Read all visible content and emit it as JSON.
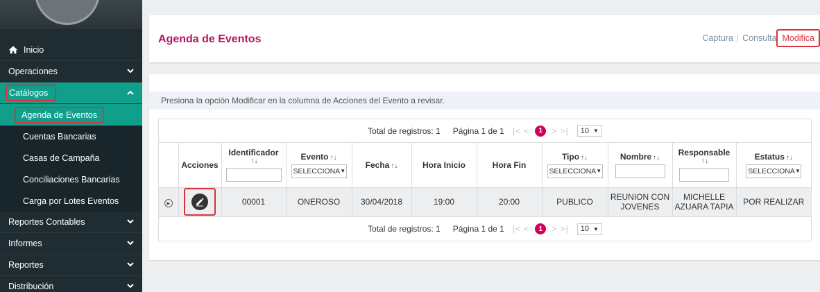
{
  "sidebar": {
    "items": [
      {
        "label": "Inicio",
        "icon": "home-icon"
      },
      {
        "label": "Operaciones",
        "icon": "chevron-down-icon"
      },
      {
        "label": "Catálogos",
        "icon": "chevron-up-icon"
      },
      {
        "label": "Reportes Contables",
        "icon": "chevron-down-icon"
      },
      {
        "label": "Informes",
        "icon": "chevron-down-icon"
      },
      {
        "label": "Reportes",
        "icon": "chevron-down-icon"
      },
      {
        "label": "Distribución",
        "icon": "chevron-down-icon"
      }
    ],
    "subitems": [
      {
        "label": "Agenda de Eventos"
      },
      {
        "label": "Cuentas Bancarias"
      },
      {
        "label": "Casas de Campaña"
      },
      {
        "label": "Conciliaciones Bancarias"
      },
      {
        "label": "Carga por Lotes Eventos"
      }
    ]
  },
  "header": {
    "title": "Agenda de Eventos",
    "links": {
      "captura": "Captura",
      "consulta": "Consulta",
      "modifica": "Modifica"
    },
    "separator": "|"
  },
  "instruction": "Presiona la opción Modificar en la columna de Acciones del Evento a revisar.",
  "pager": {
    "total": "Total de registros: 1",
    "page": "Página 1 de 1",
    "first_prev": "|< <",
    "current": "1",
    "next_last": "> >|",
    "page_size": "10"
  },
  "table": {
    "columns": {
      "acciones": "Acciones",
      "identificador": "Identificador",
      "evento": "Evento",
      "fecha": "Fecha",
      "hora_inicio": "Hora Inicio",
      "hora_fin": "Hora Fin",
      "tipo": "Tipo",
      "nombre": "Nombre",
      "responsable": "Responsable",
      "estatus": "Estatus"
    },
    "sort_glyph": "↑↓",
    "select_placeholder": "SELECCIONA",
    "rows": [
      {
        "identificador": "00001",
        "evento": "ONEROSO",
        "fecha": "30/04/2018",
        "hora_inicio": "19:00",
        "hora_fin": "20:00",
        "tipo": "PUBLICO",
        "nombre": "REUNION CON JOVENES",
        "responsable": "MICHELLE AZUARA TAPIA",
        "estatus": "POR REALIZAR"
      }
    ]
  },
  "colors": {
    "accent": "#b5165b",
    "sidebar_bg": "#1f2d33",
    "active_bg": "#0f9f8a",
    "highlight": "#d9333f",
    "page_badge": "#d1005b"
  }
}
